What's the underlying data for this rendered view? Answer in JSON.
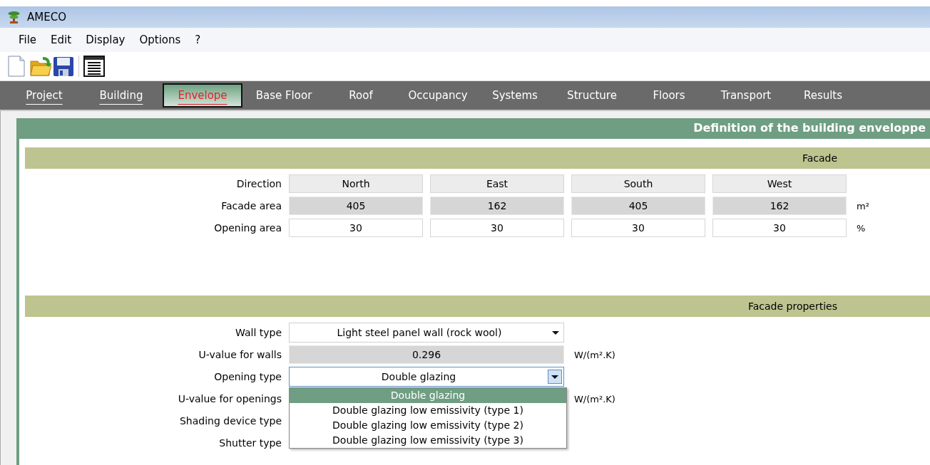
{
  "window": {
    "title": "AMECO"
  },
  "menu": [
    "File",
    "Edit",
    "Display",
    "Options",
    "?"
  ],
  "toolbar": [
    {
      "kind": "new"
    },
    {
      "kind": "open"
    },
    {
      "kind": "save"
    },
    {
      "kind": "report"
    }
  ],
  "tabs": [
    {
      "label": "Project",
      "selected": false,
      "visited": true
    },
    {
      "label": "Building",
      "selected": false,
      "visited": true
    },
    {
      "label": "Envelope",
      "selected": true,
      "visited": true
    },
    {
      "label": "Base Floor",
      "selected": false,
      "visited": false
    },
    {
      "label": "Roof",
      "selected": false,
      "visited": false
    },
    {
      "label": "Occupancy",
      "selected": false,
      "visited": false
    },
    {
      "label": "Systems",
      "selected": false,
      "visited": false
    },
    {
      "label": "Structure",
      "selected": false,
      "visited": false
    },
    {
      "label": "Floors",
      "selected": false,
      "visited": false
    },
    {
      "label": "Transport",
      "selected": false,
      "visited": false
    },
    {
      "label": "Results",
      "selected": false,
      "visited": false
    }
  ],
  "panel": {
    "title": "Definition of the building enveloppe",
    "facade": {
      "title": "Facade",
      "rows": [
        {
          "label": "Direction",
          "kind": "header",
          "cells": [
            "North",
            "East",
            "South",
            "West"
          ]
        },
        {
          "label": "Facade area",
          "kind": "readonly",
          "cells": [
            "405",
            "162",
            "405",
            "162"
          ],
          "unit": "m²"
        },
        {
          "label": "Opening area",
          "kind": "input",
          "cells": [
            "30",
            "30",
            "30",
            "30"
          ],
          "unit": "%"
        }
      ]
    },
    "properties": {
      "title": "Facade properties",
      "rows": [
        {
          "label": "Wall type",
          "kind": "dropdown",
          "value": "Light steel panel wall (rock wool)"
        },
        {
          "label": "U-value for walls",
          "kind": "readonly",
          "value": "0.296",
          "unit": "W/(m².K)"
        },
        {
          "label": "Opening type",
          "kind": "dropdown",
          "value": "Double glazing",
          "focused": true,
          "options": [
            {
              "label": "Double glazing",
              "selected": true
            },
            {
              "label": "Double glazing low emissivity (type 1)",
              "selected": false
            },
            {
              "label": "Double glazing low emissivity (type 2)",
              "selected": false
            },
            {
              "label": "Double glazing low emissivity (type 3)",
              "selected": false
            }
          ]
        },
        {
          "label": "U-value for openings",
          "kind": "hidden",
          "unit": "W/(m².K)"
        },
        {
          "label": "Shading device type",
          "kind": "hidden"
        },
        {
          "label": "Shutter type",
          "kind": "hidden"
        }
      ]
    }
  }
}
